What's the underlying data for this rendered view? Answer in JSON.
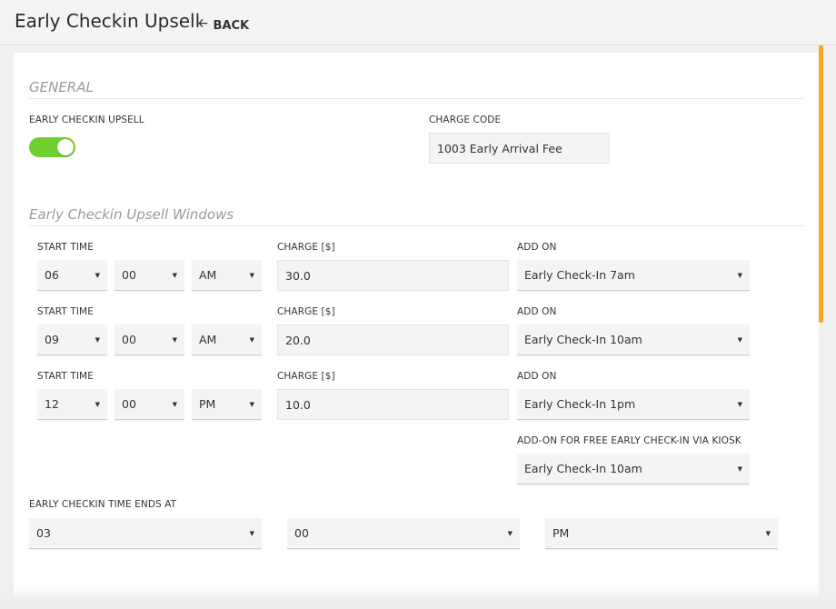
{
  "header": {
    "title": "Early Checkin Upsell",
    "back_label": "BACK"
  },
  "general": {
    "section_title": "GENERAL",
    "upsell_label": "EARLY CHECKIN UPSELL",
    "upsell_enabled": true,
    "charge_code_label": "CHARGE CODE",
    "charge_code_value": "1003 Early Arrival Fee"
  },
  "windows": {
    "section_title": "Early Checkin Upsell Windows",
    "start_time_label": "START TIME",
    "charge_label": "CHARGE [$]",
    "add_on_label": "ADD ON",
    "rows": [
      {
        "hour": "06",
        "minute": "00",
        "ampm": "AM",
        "charge": "30.0",
        "add_on": "Early Check-In 7am"
      },
      {
        "hour": "09",
        "minute": "00",
        "ampm": "AM",
        "charge": "20.0",
        "add_on": "Early Check-In 10am"
      },
      {
        "hour": "12",
        "minute": "00",
        "ampm": "PM",
        "charge": "10.0",
        "add_on": "Early Check-In 1pm"
      }
    ],
    "kiosk_label": "ADD-ON FOR FREE EARLY CHECK-IN VIA KIOSK",
    "kiosk_value": "Early Check-In 10am"
  },
  "end_time": {
    "label": "EARLY CHECKIN TIME ENDS AT",
    "hour": "03",
    "minute": "00",
    "ampm": "PM"
  },
  "colors": {
    "toggle_on": "#6fcf2e",
    "scroll_accent": "#f5a623"
  }
}
